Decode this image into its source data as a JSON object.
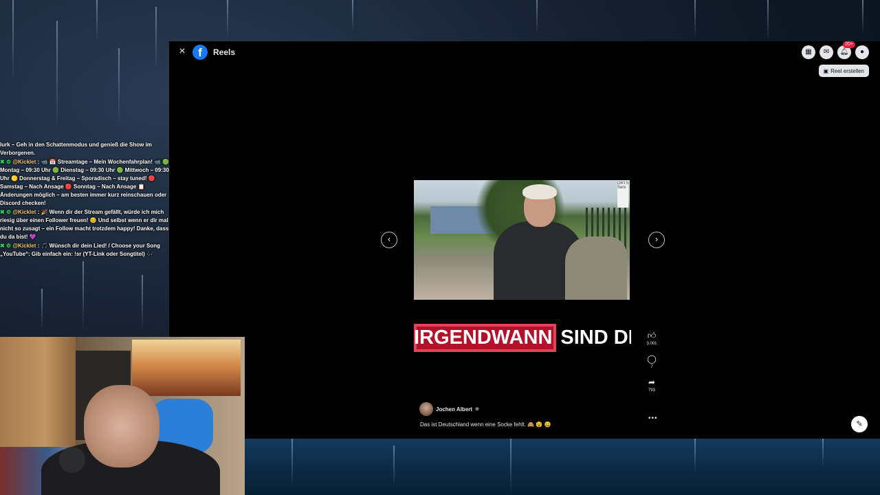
{
  "facebook": {
    "close_icon": "×",
    "logo_letter": "f",
    "title": "Reels",
    "notification_badge": "20+",
    "create_reel_label": "Reel erstellen",
    "video_caption_red": "IRGENDWANN",
    "video_caption_white": "SIND DIESE",
    "video_sign_text": "ORTS Serv",
    "likes": "3.001",
    "comments": "7",
    "shares": "793",
    "author": "Jochen Albert",
    "description": "Das ist Deutschland wenn eine Socke fehlt. 🙈 😵 😄",
    "prev_arrow": "‹",
    "next_arrow": "›"
  },
  "chat": {
    "messages": [
      {
        "user": "",
        "text": "lurk – Geh in den Schattenmodus und genieß die Show im Verborgenen."
      },
      {
        "user": "@Kicklet",
        "text": "📹 📅 Streamtage – Mein Wochenfahrplan! 📹 🟢 Montag – 09:30 Uhr 🟢 Dienstag – 09:30 Uhr 🟢 Mittwoch – 09:30 Uhr 🟡 Donnerstag & Freitag – Sporadisch – stay tuned! 🔴 Samstag – Nach Ansage 🔴 Sonntag – Nach Ansage 📋 Änderungen möglich – am besten immer kurz reinschauen oder Discord checken!"
      },
      {
        "user": "@Kicklet",
        "text": "🎉 Wenn dir der Stream gefällt, würde ich mich riesig über einen Follower freuen! 😊 Und selbst wenn er dir mal nicht so zusagt – ein Follow macht trotzdem happy! Danke, dass du da bist! 💜"
      },
      {
        "user": "@Kicklet",
        "text": "🎵 Wünsch dir dein Lied! / Choose your Song „YouTube“: Gib einfach ein: !sr (YT-Link oder Songtitel) 🎶"
      }
    ]
  }
}
